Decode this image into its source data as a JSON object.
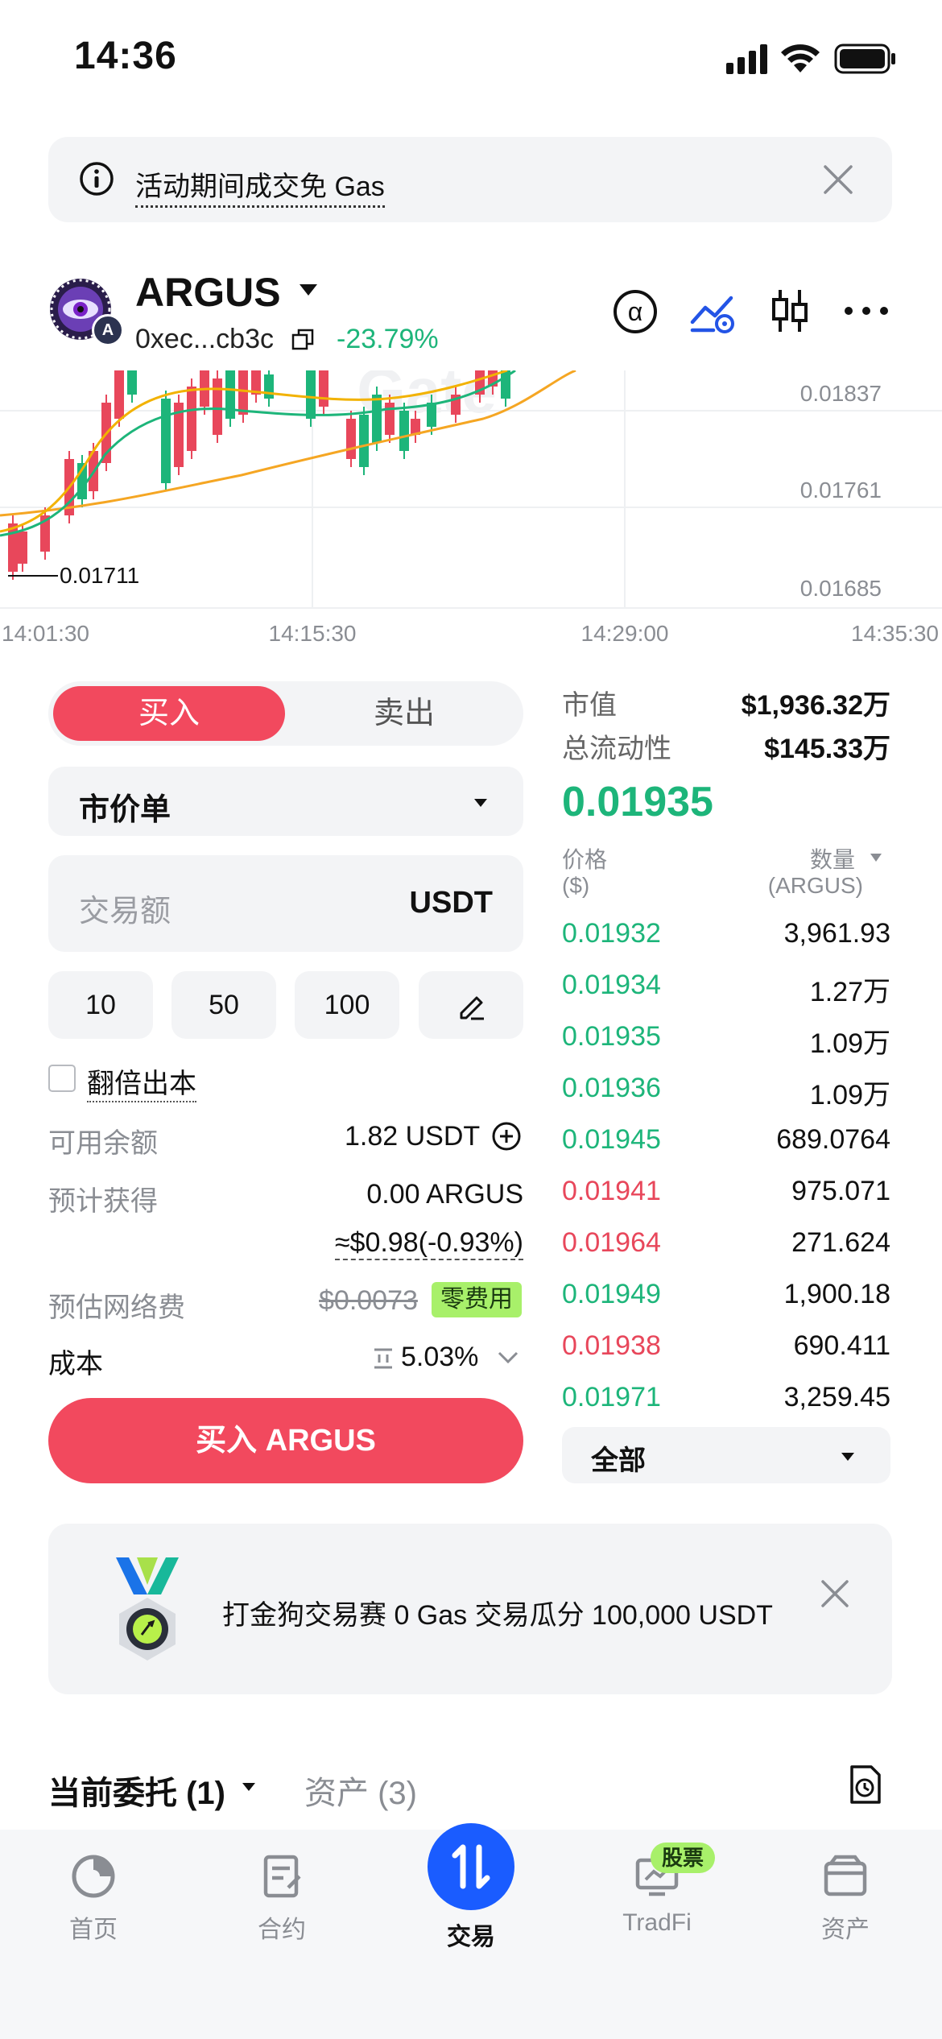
{
  "status_bar": {
    "time": "14:36"
  },
  "notice": {
    "text": "活动期间成交免 Gas"
  },
  "token": {
    "name": "ARGUS",
    "avatar_badge": "A",
    "address": "0xec...cb3c",
    "change": "-23.79%"
  },
  "chart": {
    "watermark": "Gate",
    "price_ticks": [
      "0.01837",
      "0.01761",
      "0.01685"
    ],
    "low_marker": "0.01711",
    "time_ticks": [
      "14:01:30",
      "14:15:30",
      "14:29:00",
      "14:35:30"
    ]
  },
  "trade": {
    "buy_label": "买入",
    "sell_label": "卖出",
    "order_type": "市价单",
    "amount_placeholder": "交易额",
    "amount_unit": "USDT",
    "quick_amounts": [
      "10",
      "50",
      "100"
    ],
    "double_principal_label": "翻倍出本",
    "available_label": "可用余额",
    "available_value": "1.82 USDT",
    "expected_label": "预计获得",
    "expected_value": "0.00 ARGUS",
    "expected_usd": "≈$0.98(-0.93%)",
    "fee_label": "预估网络费",
    "fee_value": "$0.0073",
    "fee_badge": "零费用",
    "cost_label": "成本",
    "cost_value": "5.03%",
    "buy_button": "买入 ARGUS"
  },
  "stats": {
    "market_cap_label": "市值",
    "market_cap_value": "$1,936.32万",
    "liquidity_label": "总流动性",
    "liquidity_value": "$145.33万",
    "current_price": "0.01935"
  },
  "orderbook": {
    "price_header": "价格",
    "price_unit": "($)",
    "qty_header": "数量",
    "qty_unit": "(ARGUS)",
    "rows": [
      {
        "price": "0.01932",
        "qty": "3,961.93",
        "side": "buy"
      },
      {
        "price": "0.01934",
        "qty": "1.27万",
        "side": "buy"
      },
      {
        "price": "0.01935",
        "qty": "1.09万",
        "side": "buy"
      },
      {
        "price": "0.01936",
        "qty": "1.09万",
        "side": "buy"
      },
      {
        "price": "0.01945",
        "qty": "689.0764",
        "side": "buy"
      },
      {
        "price": "0.01941",
        "qty": "975.071",
        "side": "sell"
      },
      {
        "price": "0.01964",
        "qty": "271.624",
        "side": "sell"
      },
      {
        "price": "0.01949",
        "qty": "1,900.18",
        "side": "buy"
      },
      {
        "price": "0.01938",
        "qty": "690.411",
        "side": "sell"
      },
      {
        "price": "0.01971",
        "qty": "3,259.45",
        "side": "buy"
      }
    ],
    "filter_label": "全部"
  },
  "promo": {
    "text": "打金狗交易赛 0 Gas 交易瓜分 100,000 USDT"
  },
  "orders": {
    "current_tab": "当前委托 (1)",
    "assets_tab": "资产 (3)"
  },
  "nav": {
    "home": "首页",
    "contract": "合约",
    "trade": "交易",
    "tradfi": "TradFi",
    "tradfi_badge": "股票",
    "assets": "资产"
  },
  "colors": {
    "up": "#1db57a",
    "down": "#e8475b",
    "accent": "#2354e6"
  }
}
